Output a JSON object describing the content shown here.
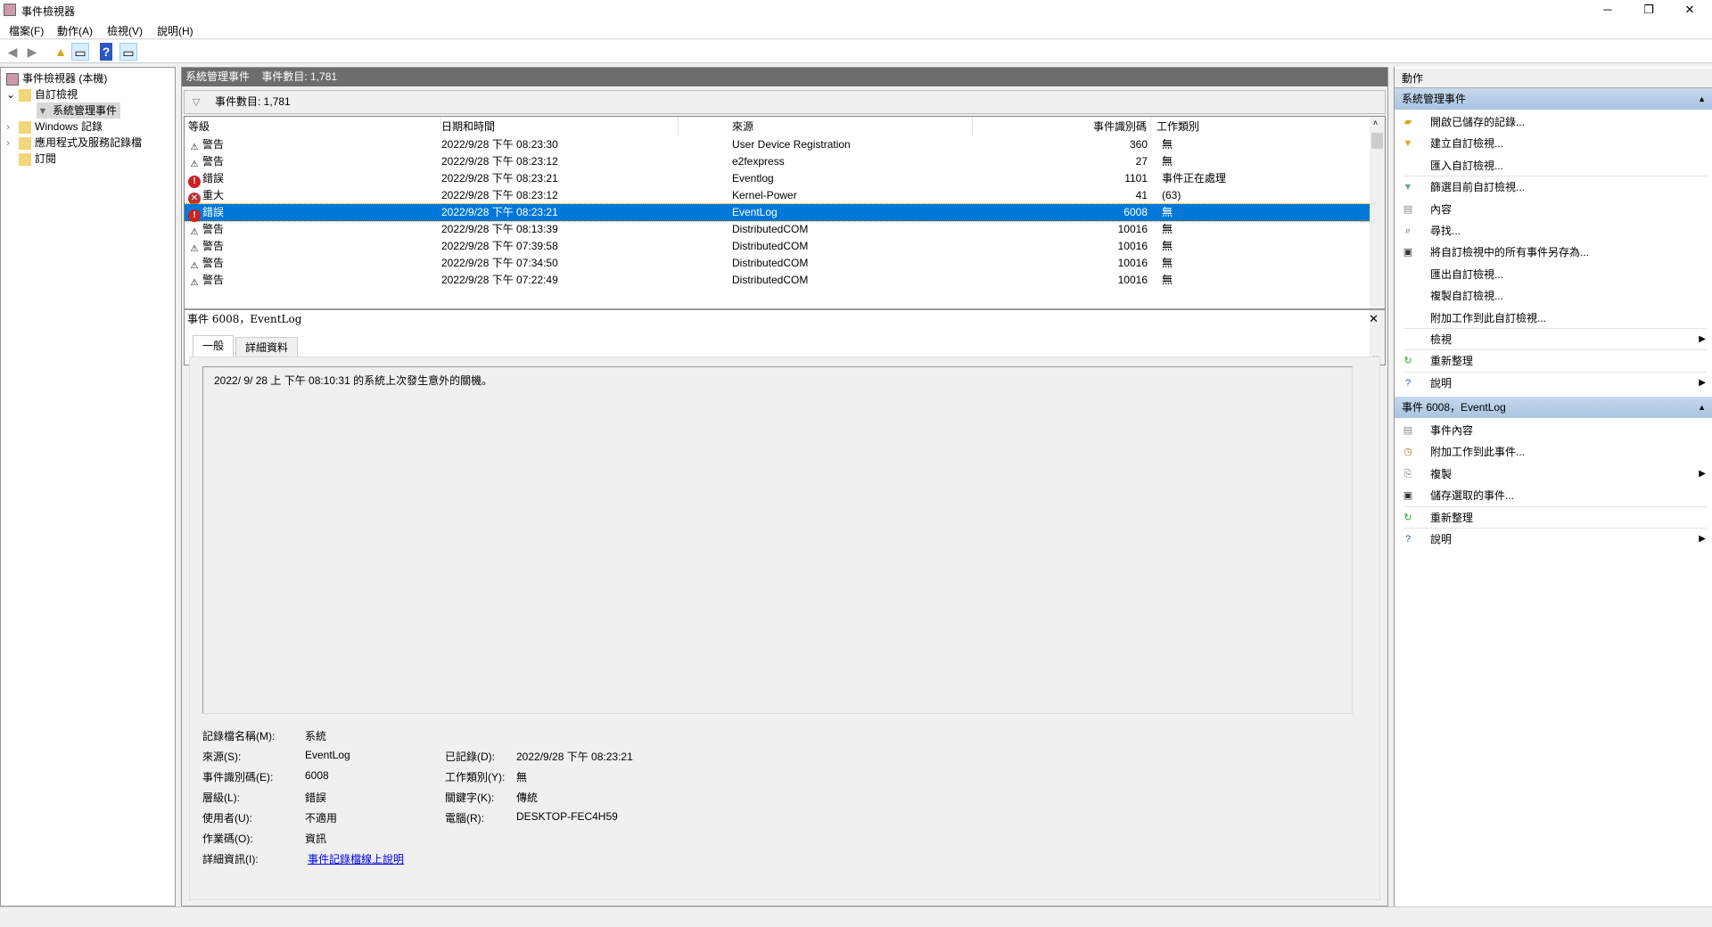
{
  "window": {
    "title": "事件檢視器",
    "minimize": "─",
    "maximize": "❐",
    "close": "✕"
  },
  "menu": [
    "檔案(F)",
    "動作(A)",
    "檢視(V)",
    "說明(H)"
  ],
  "tree": {
    "root": "事件檢視器 (本機)",
    "custom_views": "自訂檢視",
    "admin_events": "系統管理事件",
    "windows_logs": "Windows 記錄",
    "app_logs": "應用程式及服務記錄檔",
    "subscriptions": "訂閱"
  },
  "center": {
    "header_title": "系統管理事件",
    "header_count": "事件數目: 1,781",
    "filter_count": "事件數目: 1,781",
    "columns": [
      "等級",
      "日期和時間",
      "來源",
      "事件識別碼",
      "工作類別"
    ],
    "rows": [
      {
        "level": "警告",
        "type": "warn",
        "datetime": "2022/9/28 下午 08:23:30",
        "source": "User Device Registration",
        "id": "360",
        "task": "無"
      },
      {
        "level": "警告",
        "type": "warn",
        "datetime": "2022/9/28 下午 08:23:12",
        "source": "e2fexpress",
        "id": "27",
        "task": "無"
      },
      {
        "level": "錯誤",
        "type": "err",
        "datetime": "2022/9/28 下午 08:23:21",
        "source": "Eventlog",
        "id": "1101",
        "task": "事件正在處理"
      },
      {
        "level": "重大",
        "type": "crit",
        "datetime": "2022/9/28 下午 08:23:12",
        "source": "Kernel-Power",
        "id": "41",
        "task": "(63)"
      },
      {
        "level": "錯誤",
        "type": "err",
        "datetime": "2022/9/28 下午 08:23:21",
        "source": "EventLog",
        "id": "6008",
        "task": "無",
        "selected": true
      },
      {
        "level": "警告",
        "type": "warn",
        "datetime": "2022/9/28 下午 08:13:39",
        "source": "DistributedCOM",
        "id": "10016",
        "task": "無"
      },
      {
        "level": "警告",
        "type": "warn",
        "datetime": "2022/9/28 下午 07:39:58",
        "source": "DistributedCOM",
        "id": "10016",
        "task": "無"
      },
      {
        "level": "警告",
        "type": "warn",
        "datetime": "2022/9/28 下午 07:34:50",
        "source": "DistributedCOM",
        "id": "10016",
        "task": "無"
      },
      {
        "level": "警告",
        "type": "warn",
        "datetime": "2022/9/28 下午 07:22:49",
        "source": "DistributedCOM",
        "id": "10016",
        "task": "無"
      }
    ]
  },
  "detail": {
    "title": "事件 6008，EventLog",
    "tabs": [
      "一般",
      "詳細資料"
    ],
    "message": "2022/   9/   28 上 下午 08:10:31 的系統上次發生意外的關機。",
    "fields": {
      "log_name_label": "記錄檔名稱(M):",
      "log_name": "系統",
      "source_label": "來源(S):",
      "source": "EventLog",
      "logged_label": "已記錄(D):",
      "logged": "2022/9/28 下午 08:23:21",
      "event_id_label": "事件識別碼(E):",
      "event_id": "6008",
      "task_label": "工作類別(Y):",
      "task": "無",
      "level_label": "層級(L):",
      "level": "錯誤",
      "keywords_label": "關鍵字(K):",
      "keywords": "傳統",
      "user_label": "使用者(U):",
      "user": "不適用",
      "computer_label": "電腦(R):",
      "computer": "DESKTOP-FEC4H59",
      "opcode_label": "作業碼(O):",
      "opcode": "資訊",
      "more_info_label": "詳細資訊(I):",
      "more_info_link": "事件記錄檔線上說明"
    }
  },
  "actions": {
    "title": "動作",
    "section1": {
      "title": "系統管理事件",
      "items": [
        "開啟已儲存的記錄...",
        "建立自訂檢視...",
        "匯入自訂檢視...",
        "篩選目前自訂檢視...",
        "內容",
        "尋找...",
        "將自訂檢視中的所有事件另存為...",
        "匯出自訂檢視...",
        "複製自訂檢視...",
        "附加工作到此自訂檢視...",
        "檢視",
        "重新整理",
        "說明"
      ]
    },
    "section2": {
      "title": "事件 6008，EventLog",
      "items": [
        "事件內容",
        "附加工作到此事件...",
        "複製",
        "儲存選取的事件...",
        "重新整理",
        "說明"
      ]
    }
  }
}
